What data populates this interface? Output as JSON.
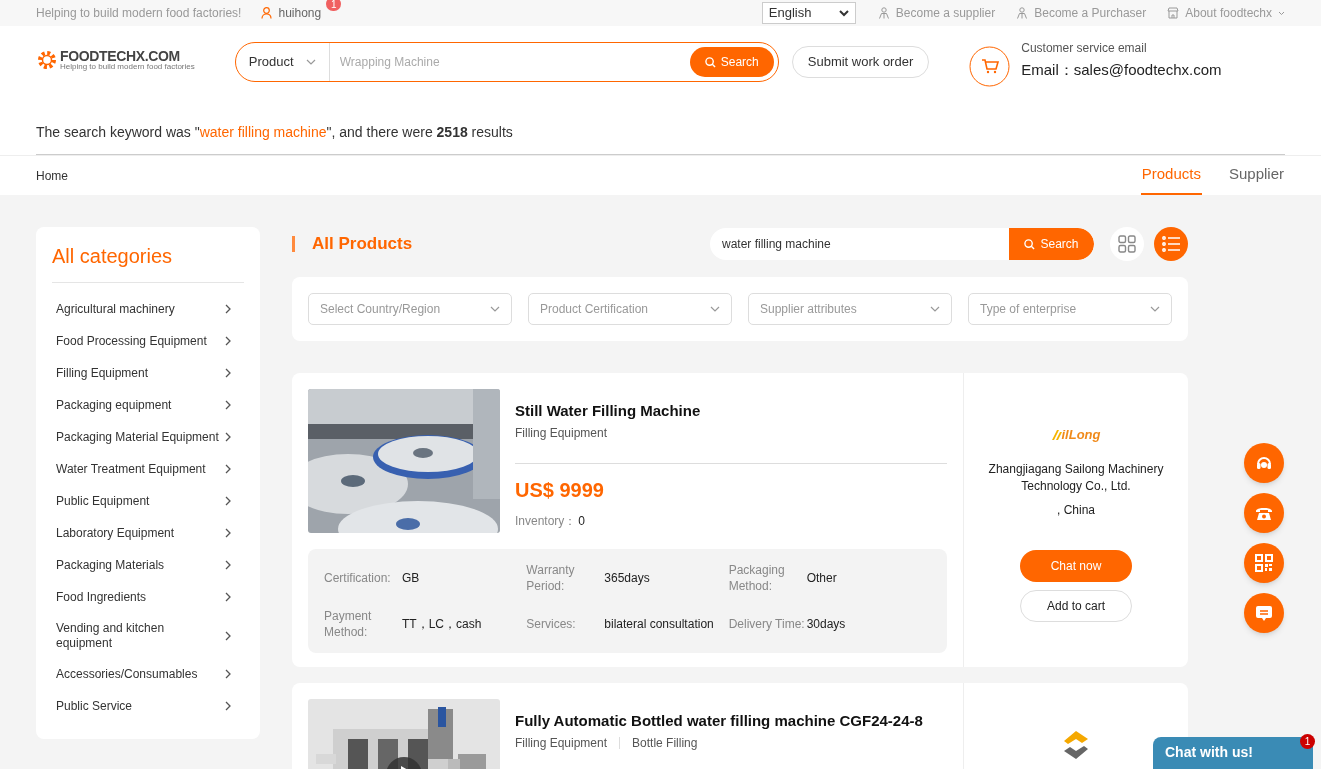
{
  "top_bar": {
    "slogan": "Helping to build modern food factories!",
    "user": "huihong",
    "user_badge": "1",
    "language": "English",
    "links": [
      {
        "label": "Become a supplier",
        "kind": "person"
      },
      {
        "label": "Become a Purchaser",
        "kind": "person"
      },
      {
        "label": "About foodtechx",
        "kind": "shop"
      }
    ]
  },
  "header": {
    "logo": {
      "name": "FOODTECHX.COM",
      "tagline": "Helping to build modern food factories"
    },
    "search": {
      "scope": "Product",
      "placeholder": "Wrapping Machine",
      "button": "Search"
    },
    "work_order_button": "Submit work order",
    "service": {
      "label": "Customer service email",
      "email": "Email：sales@foodtechx.com"
    }
  },
  "result_summary": {
    "prefix": "The search keyword was \"",
    "keyword": "water filling machine",
    "suffix": "\", and there were **2518** results"
  },
  "breadcrumb": "Home",
  "tabs": [
    {
      "label": "Products",
      "selected": true
    },
    {
      "label": "Supplier",
      "selected": false
    }
  ],
  "sidebar": {
    "title": "All categories",
    "items": [
      {
        "label": "Agricultural machinery"
      },
      {
        "label": "Food Processing Equipment"
      },
      {
        "label": "Filling Equipment"
      },
      {
        "label": "Packaging equipment"
      },
      {
        "label": "Packaging Material Equipment"
      },
      {
        "label": "Water Treatment Equipment"
      },
      {
        "label": "Public Equipment"
      },
      {
        "label": "Laboratory Equipment"
      },
      {
        "label": "Packaging Materials"
      },
      {
        "label": "Food Ingredients"
      },
      {
        "label": "Vending and kitchen equipment"
      },
      {
        "label": "Accessories/Consumables"
      },
      {
        "label": "Public Service"
      }
    ]
  },
  "products_panel": {
    "title": "All Products",
    "search_value": "water filling machine",
    "search_button": "Search",
    "views": [
      {
        "kind": "grid",
        "selected": false
      },
      {
        "kind": "list",
        "selected": true
      }
    ],
    "filters": [
      {
        "placeholder": "Select Country/Region"
      },
      {
        "placeholder": "Product Certification"
      },
      {
        "placeholder": "Supplier attributes"
      },
      {
        "placeholder": "Type of enterprise"
      }
    ]
  },
  "products": [
    {
      "title": "Still Water Filling Machine",
      "tags": [
        "Filling Equipment"
      ],
      "video": false,
      "price": "US$ 9999",
      "inventory_label": "Inventory：",
      "inventory": "0",
      "specs": [
        {
          "label": "Certification:",
          "value": "GB"
        },
        {
          "label": "Warranty Period:",
          "value": "365days"
        },
        {
          "label": "Packaging Method:",
          "value": "Other"
        },
        {
          "label": "Payment Method:",
          "value": "TT，LC，cash"
        },
        {
          "label": "Services:",
          "value": "bilateral consultation"
        },
        {
          "label": "Delivery Time:",
          "value": "30days"
        }
      ],
      "supplier": {
        "logo": "ilLong",
        "name": "Zhangjiagang Sailong Machinery Technology Co., Ltd.",
        "location": ", China",
        "chat_button": "Chat now",
        "cart_button": "Add to cart"
      }
    },
    {
      "title": "Fully Automatic Bottled water filling machine CGF24-24-8",
      "tags": [
        "Filling Equipment",
        "Bottle Filling"
      ],
      "video": true
    }
  ],
  "float_buttons": [
    {
      "kind": "headset"
    },
    {
      "kind": "phone"
    },
    {
      "kind": "qr"
    },
    {
      "kind": "message"
    }
  ],
  "chat_widget": {
    "label": "Chat with us!",
    "badge": "1"
  }
}
